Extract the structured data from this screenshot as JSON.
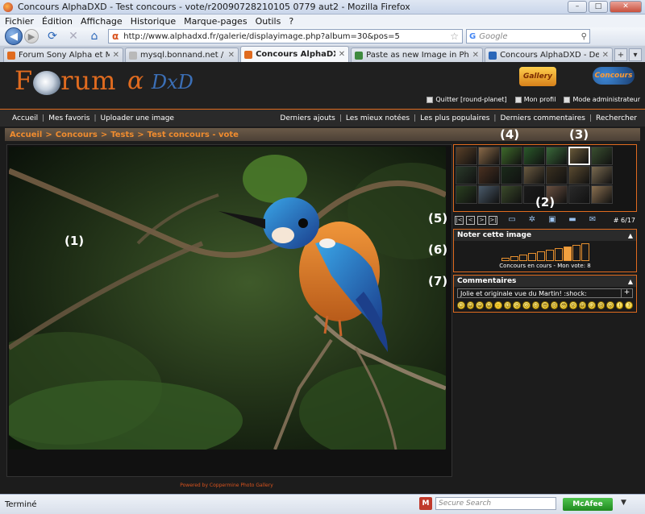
{
  "window": {
    "title": "Concours AlphaDXD - Test concours - vote/r20090728210105 0779 aut2 - Mozilla Firefox",
    "buttons": [
      "–",
      "□",
      "✕"
    ]
  },
  "menu": [
    "Fichier",
    "Édition",
    "Affichage",
    "Historique",
    "Marque-pages",
    "Outils",
    "?"
  ],
  "toolbar": {
    "url": "http://www.alphadxd.fr/galerie/displayimage.php?album=30&pos=5",
    "search_placeholder": "Google"
  },
  "tabs": [
    {
      "label": "Forum Sony Alpha et Minolta ...",
      "active": false,
      "icon_color": "#e06b1f"
    },
    {
      "label": "mysql.bonnand.net / localhos...",
      "active": false,
      "icon_color": "#b9b9b9"
    },
    {
      "label": "Concours AlphaDXD - Test c...",
      "active": true,
      "icon_color": "#e06b1f"
    },
    {
      "label": "Paste as new Image in Photos...",
      "active": false,
      "icon_color": "#3e8a3e"
    },
    {
      "label": "Concours AlphaDXD - Dernier...",
      "active": false,
      "icon_color": "#2a66b8"
    }
  ],
  "site": {
    "logo_forum": "F  rum",
    "logo_alpha": "α",
    "logo_dxd": "DxD",
    "gallery_logo": "Gallery",
    "concours_logo": "Concours",
    "userlinks": [
      "Quitter [round-planet]",
      "Mon profil",
      "Mode administrateur"
    ],
    "nav_left": [
      "Accueil",
      "Mes favoris",
      "Uploader une image"
    ],
    "nav_right": [
      "Derniers ajouts",
      "Les mieux notées",
      "Les plus populaires",
      "Derniers commentaires",
      "Rechercher"
    ],
    "breadcrumb": [
      "Accueil",
      "Concours",
      "Tests",
      "Test concours - vote"
    ],
    "powered": "Powered by Coppermine Photo Gallery"
  },
  "filmstrip": {
    "thumb_colors": [
      "#5a4028",
      "#8a6a48",
      "#3e6a2a",
      "#2a5a2a",
      "#3a6a3a",
      "#6a5a3a",
      "#3a5030",
      "#2a3a2a",
      "#4a3020",
      "#1a2a1a",
      "#6a5a40",
      "#3a3020",
      "#5a4a30",
      "#7a6a50",
      "#2a4020",
      "#4a5a6a",
      "#3a4a2a",
      "#1a1a1a",
      "#6a5040",
      "#2a2a2a",
      "#8a7050"
    ],
    "selected_index": 5,
    "page_indicator": "# 6/17",
    "tool_icons": [
      "first-icon",
      "prev-icon",
      "next-icon",
      "last-icon",
      "slideshow-icon",
      "info-icon",
      "favorites-icon",
      "comment-icon",
      "email-icon"
    ]
  },
  "rating": {
    "title": "Noter cette image",
    "caption": "Concours en cours - Mon vote: 8",
    "levels": 10,
    "selected": 8
  },
  "comments": {
    "title": "Commentaires",
    "input_value": "Jolie et originale vue du Martin!  :shock:",
    "plus": "+",
    "smilies": [
      "😊",
      "😄",
      "😁",
      "😃",
      "🙂",
      "😉",
      "😮",
      "😕",
      "😐",
      "😎",
      "😠",
      "😳",
      "😵",
      "😆",
      "😏",
      "😢",
      "😛",
      "!",
      "?"
    ]
  },
  "annotations": [
    {
      "label": "(1)"
    },
    {
      "label": "(2)"
    },
    {
      "label": "(3)"
    },
    {
      "label": "(4)"
    },
    {
      "label": "(5)"
    },
    {
      "label": "(6)"
    },
    {
      "label": "(7)"
    }
  ],
  "status": {
    "text": "Terminé",
    "secure_search": "Secure Search",
    "mcafee": "McAfee"
  }
}
